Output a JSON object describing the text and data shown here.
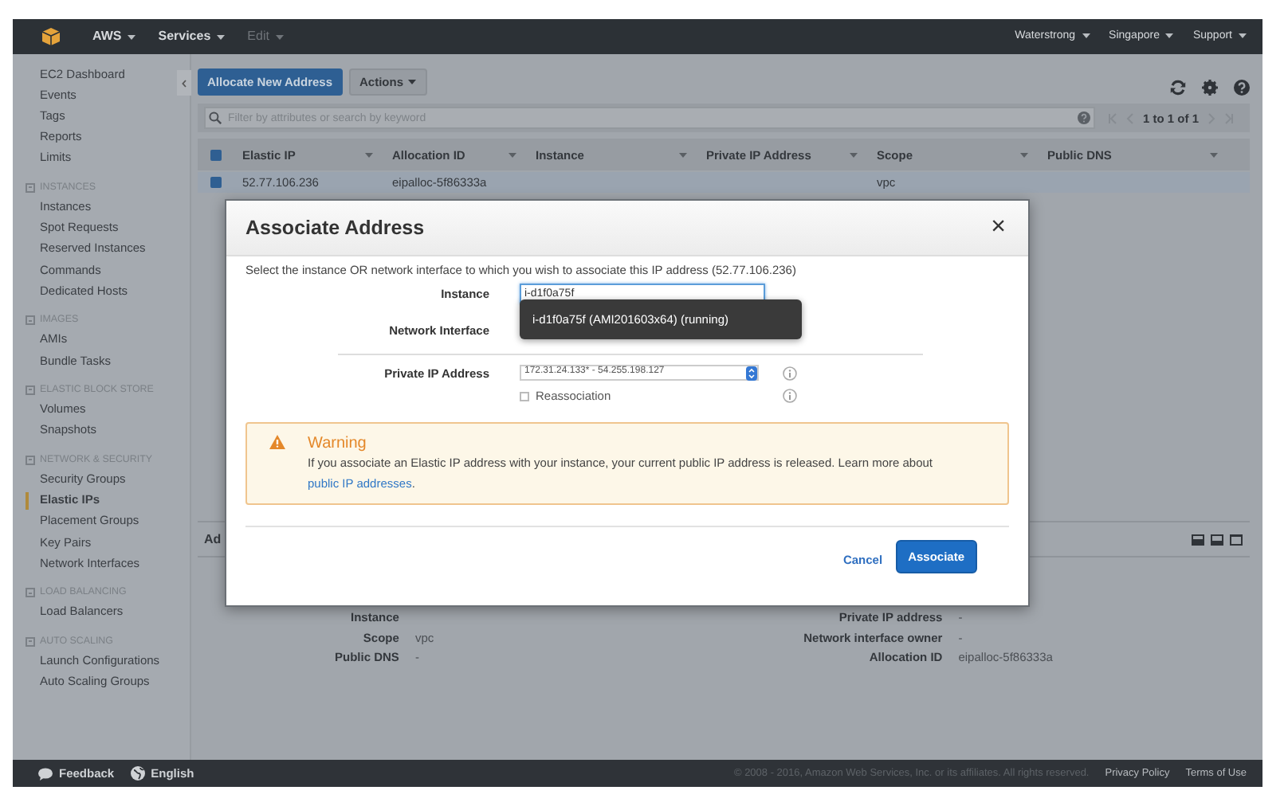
{
  "top_bar": {
    "menus": [
      {
        "label": "AWS",
        "disabled": false
      },
      {
        "label": "Services",
        "disabled": false
      },
      {
        "label": "Edit",
        "disabled": true
      }
    ],
    "right_menus": [
      {
        "label": "Waterstrong"
      },
      {
        "label": "Singapore"
      },
      {
        "label": "Support"
      }
    ]
  },
  "sidebar": {
    "items": [
      {
        "label": "EC2 Dashboard",
        "selected": false
      },
      {
        "label": "Events",
        "selected": false
      },
      {
        "label": "Tags",
        "selected": false
      },
      {
        "label": "Reports",
        "selected": false
      },
      {
        "label": "Limits",
        "selected": false
      }
    ],
    "groups": [
      {
        "title": "INSTANCES",
        "expanded": true,
        "items": [
          {
            "label": "Instances",
            "selected": false
          },
          {
            "label": "Spot Requests",
            "selected": false
          },
          {
            "label": "Reserved Instances",
            "selected": false
          },
          {
            "label": "Commands",
            "selected": false
          },
          {
            "label": "Dedicated Hosts",
            "selected": false
          }
        ]
      },
      {
        "title": "IMAGES",
        "expanded": true,
        "items": [
          {
            "label": "AMIs",
            "selected": false
          },
          {
            "label": "Bundle Tasks",
            "selected": false
          }
        ]
      },
      {
        "title": "ELASTIC BLOCK STORE",
        "expanded": true,
        "items": [
          {
            "label": "Volumes",
            "selected": false
          },
          {
            "label": "Snapshots",
            "selected": false
          }
        ]
      },
      {
        "title": "NETWORK & SECURITY",
        "expanded": true,
        "items": [
          {
            "label": "Security Groups",
            "selected": false
          },
          {
            "label": "Elastic IPs",
            "selected": true
          },
          {
            "label": "Placement Groups",
            "selected": false
          },
          {
            "label": "Key Pairs",
            "selected": false
          },
          {
            "label": "Network Interfaces",
            "selected": false
          }
        ]
      },
      {
        "title": "LOAD BALANCING",
        "expanded": true,
        "items": [
          {
            "label": "Load Balancers",
            "selected": false
          }
        ]
      },
      {
        "title": "AUTO SCALING",
        "expanded": true,
        "items": [
          {
            "label": "Launch Configurations",
            "selected": false
          },
          {
            "label": "Auto Scaling Groups",
            "selected": false
          }
        ]
      }
    ]
  },
  "toolbar": {
    "primary_button": "Allocate New Address",
    "actions_button": "Actions"
  },
  "filter": {
    "placeholder": "Filter by attributes or search by keyword",
    "pagination": "1 to 1 of 1"
  },
  "table": {
    "all_checked": true,
    "columns": [
      "Elastic IP",
      "Allocation ID",
      "Instance",
      "Private IP Address",
      "Scope",
      "Public DNS"
    ],
    "rows": [
      {
        "selected": true,
        "cells": [
          "52.77.106.236",
          "eipalloc-5f86333a",
          "",
          "",
          "vpc",
          ""
        ]
      }
    ]
  },
  "details": {
    "heading": "Ad",
    "left": [
      {
        "label": "Instance"
      },
      {
        "label": "Scope",
        "value": "vpc"
      },
      {
        "label": "Public DNS",
        "value": "-"
      }
    ],
    "right": [
      {
        "label": "Private IP address",
        "value": "-"
      },
      {
        "label": "Network interface owner",
        "value": "-"
      },
      {
        "label": "Allocation ID",
        "value": "eipalloc-5f86333a"
      }
    ]
  },
  "dialog": {
    "title": "Associate Address",
    "close": "×",
    "description": "Select the instance OR network interface to which you wish to associate this IP address (52.77.106.236)",
    "instance_label": "Instance",
    "instance_value": "i-d1f0a75f",
    "suggestion": "i-d1f0a75f (AMI201603x64) (running)",
    "network_interface_label": "Network Interface",
    "private_ip_label": "Private IP Address",
    "private_ip_value": "172.31.24.133* - 54.255.198.127",
    "reassociation": {
      "label": "Reassociation",
      "checked": false
    },
    "warning": {
      "title": "Warning",
      "text": "If you associate an Elastic IP address with your instance, your current public IP address is released. Learn more about",
      "link": "public IP addresses",
      "after": "."
    },
    "cancel": "Cancel",
    "confirm": "Associate"
  },
  "footer": {
    "feedback": "Feedback",
    "language": "English",
    "copyright": "© 2008 - 2016, Amazon Web Services, Inc. or its affiliates. All rights reserved.",
    "links": [
      "Privacy Policy",
      "Terms of Use"
    ]
  }
}
